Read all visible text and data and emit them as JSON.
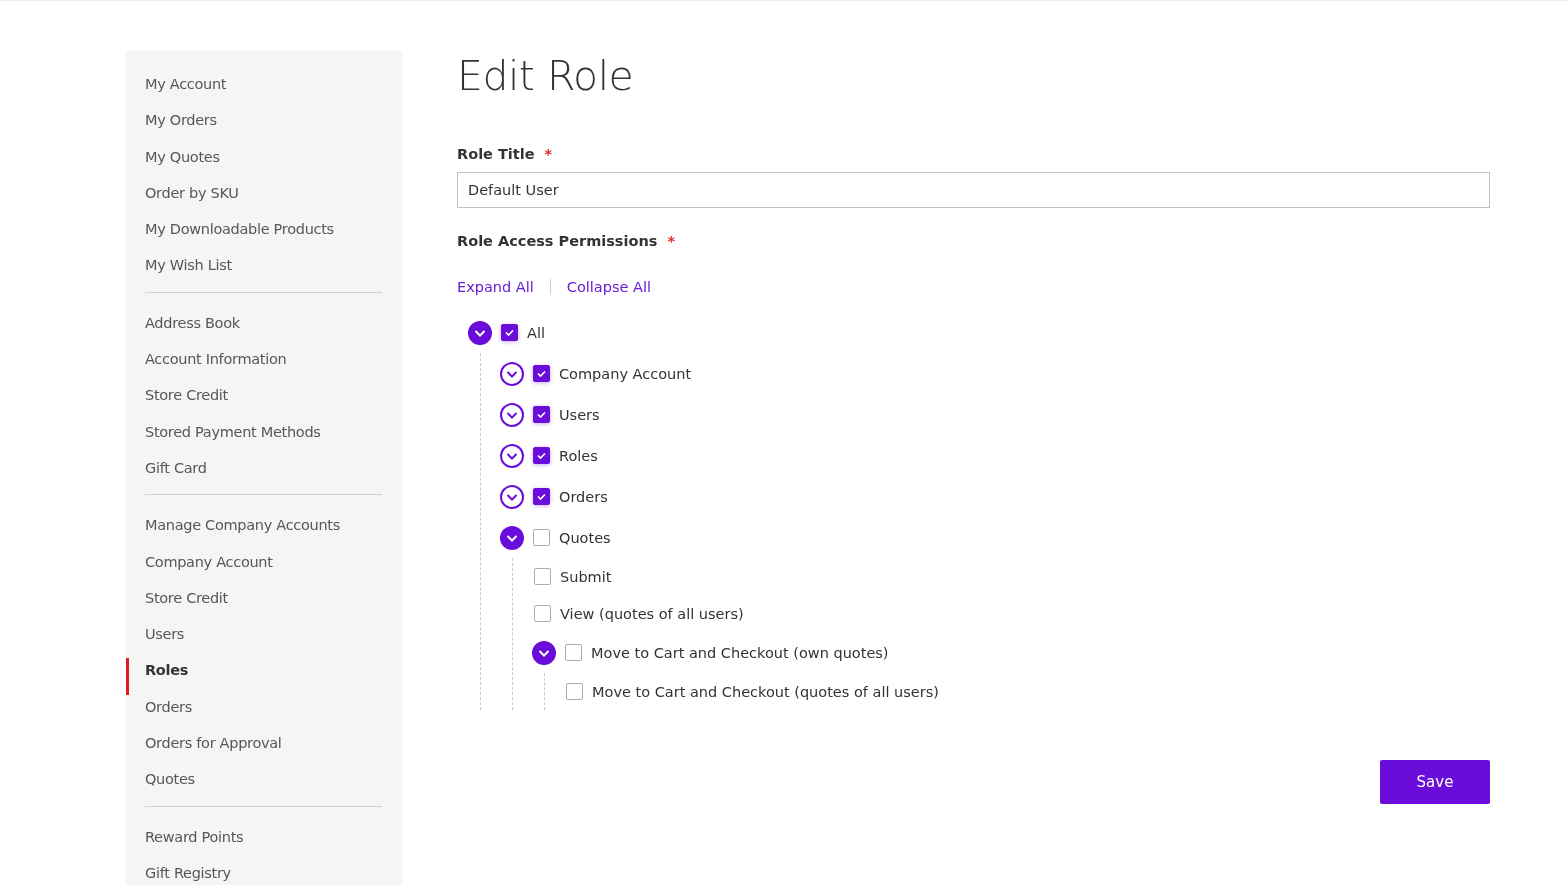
{
  "sidebar": {
    "groups": [
      {
        "items": [
          {
            "label": "My Account",
            "selected": false
          },
          {
            "label": "My Orders",
            "selected": false
          },
          {
            "label": "My Quotes",
            "selected": false
          },
          {
            "label": "Order by SKU",
            "selected": false
          },
          {
            "label": "My Downloadable Products",
            "selected": false
          },
          {
            "label": "My Wish List",
            "selected": false
          }
        ]
      },
      {
        "items": [
          {
            "label": "Address Book",
            "selected": false
          },
          {
            "label": "Account Information",
            "selected": false
          },
          {
            "label": "Store Credit",
            "selected": false
          },
          {
            "label": "Stored Payment Methods",
            "selected": false
          },
          {
            "label": "Gift Card",
            "selected": false
          }
        ]
      },
      {
        "items": [
          {
            "label": "Manage Company Accounts",
            "selected": false
          },
          {
            "label": "Company Account",
            "selected": false
          },
          {
            "label": "Store Credit",
            "selected": false
          },
          {
            "label": "Users",
            "selected": false
          },
          {
            "label": "Roles",
            "selected": true
          },
          {
            "label": "Orders",
            "selected": false
          },
          {
            "label": "Orders for Approval",
            "selected": false
          },
          {
            "label": "Quotes",
            "selected": false
          }
        ]
      },
      {
        "items": [
          {
            "label": "Reward Points",
            "selected": false
          },
          {
            "label": "Gift Registry",
            "selected": false
          }
        ]
      }
    ]
  },
  "page_title": "Edit Role",
  "role_title": {
    "label": "Role Title",
    "required_mark": "*",
    "value": "Default User"
  },
  "permissions": {
    "label": "Role Access Permissions",
    "required_mark": "*",
    "expand_all": "Expand All",
    "collapse_all": "Collapse All",
    "tree": [
      {
        "label": "All",
        "checked": true,
        "expanded": true,
        "children": [
          {
            "label": "Company Account",
            "checked": true,
            "expanded": false
          },
          {
            "label": "Users",
            "checked": true,
            "expanded": false
          },
          {
            "label": "Roles",
            "checked": true,
            "expanded": false
          },
          {
            "label": "Orders",
            "checked": true,
            "expanded": false
          },
          {
            "label": "Quotes",
            "checked": false,
            "expanded": true,
            "children": [
              {
                "label": "Submit",
                "checked": false
              },
              {
                "label": "View (quotes of all users)",
                "checked": false
              },
              {
                "label": "Move to Cart and Checkout (own quotes)",
                "checked": false,
                "expanded": true,
                "children": [
                  {
                    "label": "Move to Cart and Checkout (quotes of all users)",
                    "checked": false
                  }
                ]
              }
            ]
          }
        ]
      }
    ]
  },
  "save_button": "Save"
}
